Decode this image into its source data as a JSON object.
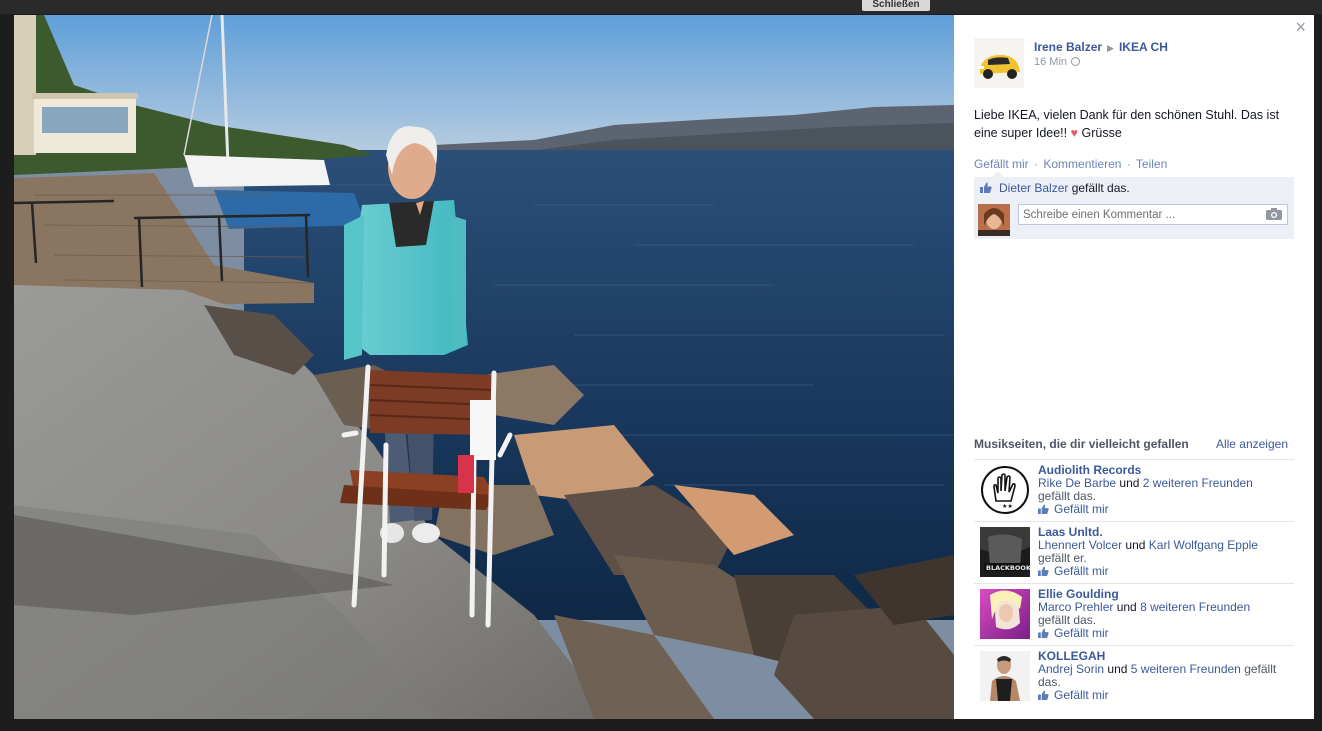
{
  "backdrop": {
    "close_button_label": "Schließen"
  },
  "photo": {
    "alt": ""
  },
  "sidebar": {
    "close_glyph": "×",
    "post": {
      "author": "Irene Balzer",
      "target_page": "IKEA CH",
      "time": "16 Min",
      "text_main": "Liebe IKEA, vielen Dank für den schönen Stuhl. Das ist eine super Idee!!",
      "heart_glyph": "♥",
      "text_end": "Grüsse"
    },
    "actions": {
      "like": "Gefällt mir",
      "comment": "Kommentieren",
      "share": "Teilen",
      "separator": "·"
    },
    "likes": {
      "name": "Dieter Balzer",
      "suffix": "gefällt das."
    },
    "comment_box": {
      "placeholder": "Schreibe einen Kommentar ...",
      "value": ""
    },
    "recommendations": {
      "title": "Musikseiten, die dir vielleicht gefallen",
      "see_all": "Alle anzeigen",
      "like_label": "Gefällt mir",
      "items": [
        {
          "name": "Audiolith Records",
          "friend": "Rike De Barbe",
          "joiner": "und",
          "others": "2 weiteren Freunden",
          "tail": "gefällt das."
        },
        {
          "name": "Laas Unltd.",
          "friend": "Lhennert Volcer",
          "joiner": "und",
          "others": "Karl Wolfgang Epple",
          "tail": "gefällt er."
        },
        {
          "name": "Ellie Goulding",
          "friend": "Marco Prehler",
          "joiner": "und",
          "others": "8 weiteren Freunden",
          "tail": "gefällt das."
        },
        {
          "name": "KOLLEGAH",
          "friend": "Andrej Sorin",
          "joiner": "und",
          "others": "5 weiteren Freunden",
          "tail": "gefällt das."
        }
      ]
    }
  },
  "colors": {
    "link": "#3b5998",
    "ufi_bg": "#eceff5",
    "water": "#1e3f66",
    "sky": "#7fb2e0"
  },
  "icons": [
    "close-icon",
    "arrow-right-icon",
    "globe-icon",
    "heart-icon",
    "thumbs-up-icon",
    "camera-icon"
  ]
}
